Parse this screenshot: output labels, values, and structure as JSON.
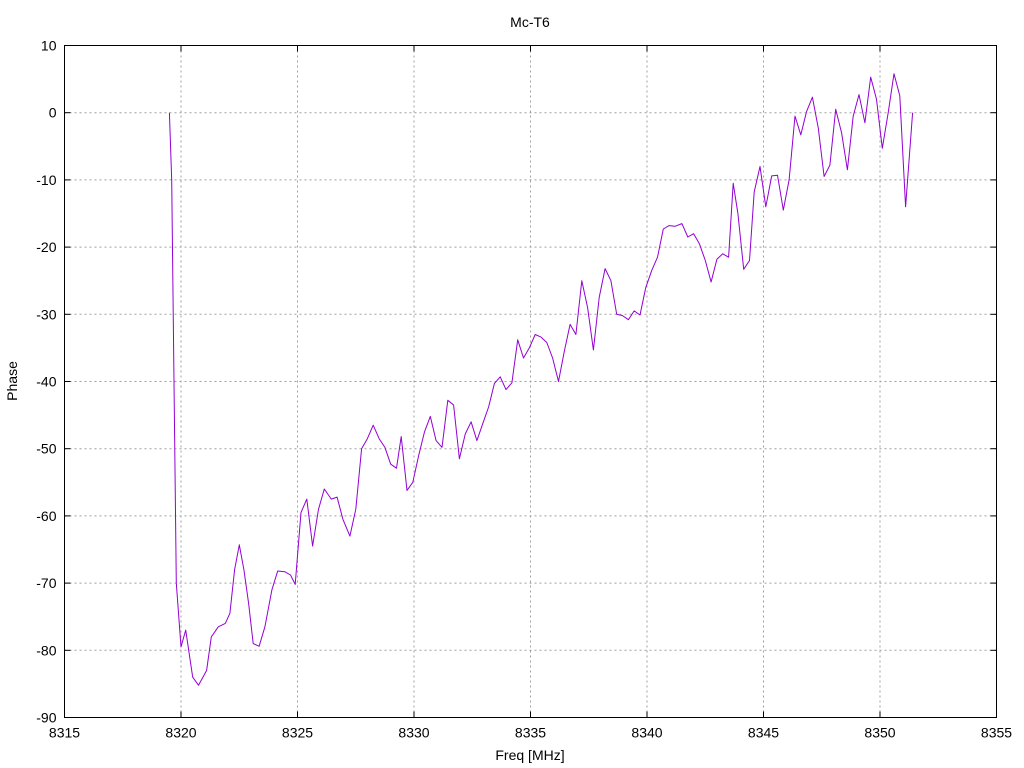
{
  "chart_data": {
    "type": "line",
    "title": "Mc-T6",
    "xlabel": "Freq [MHz]",
    "ylabel": "Phase",
    "xlim": [
      8315,
      8355
    ],
    "ylim": [
      -90,
      10
    ],
    "xticks": [
      8315,
      8320,
      8325,
      8330,
      8335,
      8340,
      8345,
      8350,
      8355
    ],
    "yticks": [
      -90,
      -80,
      -70,
      -60,
      -50,
      -40,
      -30,
      -20,
      -10,
      0,
      10
    ],
    "grid": true,
    "legend": "none",
    "series": [
      {
        "color": "#9400d3",
        "points": [
          [
            8319.5,
            0
          ],
          [
            8319.6,
            -10
          ],
          [
            8319.7,
            -40
          ],
          [
            8319.8,
            -70
          ],
          [
            8320.0,
            -79.5
          ],
          [
            8320.2,
            -77
          ],
          [
            8320.5,
            -84
          ],
          [
            8320.75,
            -85.2
          ],
          [
            8321.1,
            -83
          ],
          [
            8321.3,
            -78
          ],
          [
            8321.6,
            -76.5
          ],
          [
            8321.9,
            -76
          ],
          [
            8322.1,
            -74.5
          ],
          [
            8322.3,
            -68
          ],
          [
            8322.5,
            -64.3
          ],
          [
            8322.7,
            -68
          ],
          [
            8322.9,
            -73
          ],
          [
            8323.1,
            -79
          ],
          [
            8323.35,
            -79.4
          ],
          [
            8323.6,
            -76.5
          ],
          [
            8323.9,
            -71
          ],
          [
            8324.15,
            -68.2
          ],
          [
            8324.45,
            -68.3
          ],
          [
            8324.7,
            -68.8
          ],
          [
            8324.9,
            -70.2
          ],
          [
            8325.15,
            -59.5
          ],
          [
            8325.4,
            -57.5
          ],
          [
            8325.65,
            -64.5
          ],
          [
            8325.9,
            -59
          ],
          [
            8326.15,
            -56
          ],
          [
            8326.45,
            -57.5
          ],
          [
            8326.7,
            -57.2
          ],
          [
            8326.95,
            -60.5
          ],
          [
            8327.25,
            -63
          ],
          [
            8327.5,
            -59
          ],
          [
            8327.75,
            -50
          ],
          [
            8328.0,
            -48.5
          ],
          [
            8328.25,
            -46.5
          ],
          [
            8328.5,
            -48.5
          ],
          [
            8328.75,
            -49.8
          ],
          [
            8329.0,
            -52.3
          ],
          [
            8329.25,
            -52.9
          ],
          [
            8329.45,
            -48.2
          ],
          [
            8329.7,
            -56.2
          ],
          [
            8329.95,
            -55
          ],
          [
            8330.2,
            -51
          ],
          [
            8330.45,
            -47.5
          ],
          [
            8330.7,
            -45.2
          ],
          [
            8330.95,
            -48.8
          ],
          [
            8331.2,
            -49.8
          ],
          [
            8331.45,
            -42.8
          ],
          [
            8331.7,
            -43.5
          ],
          [
            8331.95,
            -51.5
          ],
          [
            8332.2,
            -47.8
          ],
          [
            8332.45,
            -46
          ],
          [
            8332.7,
            -48.8
          ],
          [
            8332.95,
            -46.3
          ],
          [
            8333.2,
            -43.8
          ],
          [
            8333.45,
            -40.3
          ],
          [
            8333.7,
            -39.3
          ],
          [
            8333.95,
            -41.2
          ],
          [
            8334.2,
            -40.2
          ],
          [
            8334.45,
            -33.8
          ],
          [
            8334.7,
            -36.5
          ],
          [
            8334.95,
            -35
          ],
          [
            8335.2,
            -33
          ],
          [
            8335.45,
            -33.4
          ],
          [
            8335.7,
            -34.2
          ],
          [
            8335.95,
            -36.5
          ],
          [
            8336.2,
            -40
          ],
          [
            8336.45,
            -35.5
          ],
          [
            8336.7,
            -31.5
          ],
          [
            8336.95,
            -33
          ],
          [
            8337.2,
            -25
          ],
          [
            8337.45,
            -29
          ],
          [
            8337.7,
            -35.3
          ],
          [
            8337.95,
            -27.5
          ],
          [
            8338.2,
            -23.2
          ],
          [
            8338.45,
            -25
          ],
          [
            8338.7,
            -30
          ],
          [
            8338.95,
            -30.2
          ],
          [
            8339.2,
            -30.8
          ],
          [
            8339.45,
            -29.5
          ],
          [
            8339.7,
            -30.1
          ],
          [
            8339.95,
            -26
          ],
          [
            8340.2,
            -23.5
          ],
          [
            8340.45,
            -21.5
          ],
          [
            8340.7,
            -17.3
          ],
          [
            8340.95,
            -16.8
          ],
          [
            8341.2,
            -16.9
          ],
          [
            8341.5,
            -16.5
          ],
          [
            8341.75,
            -18.5
          ],
          [
            8342.0,
            -18
          ],
          [
            8342.25,
            -19.5
          ],
          [
            8342.5,
            -22
          ],
          [
            8342.75,
            -25.2
          ],
          [
            8343.0,
            -21.8
          ],
          [
            8343.25,
            -21
          ],
          [
            8343.5,
            -21.5
          ],
          [
            8343.7,
            -10.5
          ],
          [
            8343.9,
            -15
          ],
          [
            8344.15,
            -23.3
          ],
          [
            8344.4,
            -22
          ],
          [
            8344.6,
            -11.8
          ],
          [
            8344.85,
            -8
          ],
          [
            8345.1,
            -14
          ],
          [
            8345.35,
            -9.4
          ],
          [
            8345.6,
            -9.3
          ],
          [
            8345.85,
            -14.5
          ],
          [
            8346.1,
            -10
          ],
          [
            8346.35,
            -0.5
          ],
          [
            8346.6,
            -3.3
          ],
          [
            8346.85,
            0.2
          ],
          [
            8347.1,
            2.3
          ],
          [
            8347.35,
            -2.3
          ],
          [
            8347.6,
            -9.5
          ],
          [
            8347.85,
            -7.8
          ],
          [
            8348.1,
            0.5
          ],
          [
            8348.35,
            -3
          ],
          [
            8348.6,
            -8.5
          ],
          [
            8348.85,
            -0.5
          ],
          [
            8349.1,
            2.7
          ],
          [
            8349.35,
            -1.5
          ],
          [
            8349.6,
            5.3
          ],
          [
            8349.85,
            2
          ],
          [
            8350.1,
            -5.3
          ],
          [
            8350.35,
            0
          ],
          [
            8350.6,
            5.8
          ],
          [
            8350.85,
            2.5
          ],
          [
            8351.1,
            -14
          ],
          [
            8351.4,
            0
          ]
        ]
      }
    ]
  }
}
